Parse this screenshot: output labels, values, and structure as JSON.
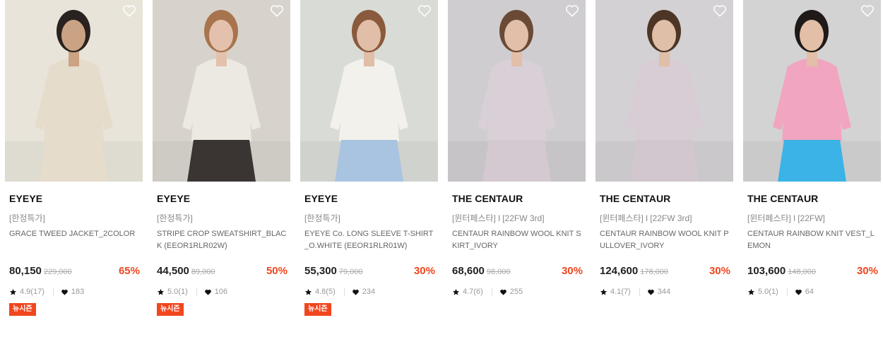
{
  "products": [
    {
      "brand": "EYEYE",
      "tag": "[한정특가]",
      "name": "GRACE TWEED JACKET_2COLOR",
      "price": "80,150",
      "original_price": "229,000",
      "discount": "65%",
      "rating": "4.9(17)",
      "likes": "183",
      "badge": "뉴시즌",
      "photo": {
        "bg": "#e8e4da",
        "garment": "#e6dccb",
        "bottom": "#e6dccb",
        "skin": "#c9a383",
        "hair": "#2a2220"
      }
    },
    {
      "brand": "EYEYE",
      "tag": "[한정특가]",
      "name": "STRIPE CROP SWEATSHIRT_BLACK (EEOR1RLR02W)",
      "price": "44,500",
      "original_price": "89,000",
      "discount": "50%",
      "rating": "5.0(1)",
      "likes": "106",
      "badge": "뉴시즌",
      "photo": {
        "bg": "#d7d3cc",
        "garment": "#ece9e3",
        "bottom": "#3a3432",
        "skin": "#e3c1ad",
        "hair": "#a8744e"
      }
    },
    {
      "brand": "EYEYE",
      "tag": "[한정특가]",
      "name": "EYEYE Co. LONG SLEEVE T-SHIRT_O.WHITE (EEOR1RLR01W)",
      "price": "55,300",
      "original_price": "79,000",
      "discount": "30%",
      "rating": "4.8(5)",
      "likes": "234",
      "badge": "뉴시즌",
      "photo": {
        "bg": "#d9dbd6",
        "garment": "#f2f1ec",
        "bottom": "#a9c4e0",
        "skin": "#e0bea8",
        "hair": "#8a5a3c"
      }
    },
    {
      "brand": "THE CENTAUR",
      "tag": "[윈터페스타] l [22FW 3rd]",
      "name": "CENTAUR RAINBOW WOOL KNIT SKIRT_IVORY",
      "price": "68,600",
      "original_price": "98,000",
      "discount": "30%",
      "rating": "4.7(6)",
      "likes": "255",
      "badge": "",
      "photo": {
        "bg": "#cfcdd0",
        "garment": "#d9cfd6",
        "bottom": "#d4c9d0",
        "skin": "#e1bfa9",
        "hair": "#6b4a35"
      }
    },
    {
      "brand": "THE CENTAUR",
      "tag": "[윈터페스타] l [22FW 3rd]",
      "name": "CENTAUR RAINBOW WOOL KNIT PULLOVER_IVORY",
      "price": "124,600",
      "original_price": "178,000",
      "discount": "30%",
      "rating": "4.1(7)",
      "likes": "344",
      "badge": "",
      "photo": {
        "bg": "#d3d1d4",
        "garment": "#d8cdd4",
        "bottom": "#d2c7ce",
        "skin": "#e0bfa8",
        "hair": "#4e3626"
      }
    },
    {
      "brand": "THE CENTAUR",
      "tag": "[윈터페스타] l [22FW]",
      "name": "CENTAUR RAINBOW KNIT VEST_LEMON",
      "price": "103,600",
      "original_price": "148,000",
      "discount": "30%",
      "rating": "5.0(1)",
      "likes": "64",
      "badge": "",
      "photo": {
        "bg": "#d3d3d3",
        "garment": "#f2a5c0",
        "bottom": "#3bb3e6",
        "skin": "#e2bfa6",
        "hair": "#1f1a18"
      }
    }
  ],
  "colors": {
    "accent": "#f1461e",
    "text": "#222222",
    "muted": "#888888"
  },
  "icons": {
    "wishlist": "heart-outline-icon",
    "rating": "star-icon",
    "likes": "heart-filled-icon"
  }
}
